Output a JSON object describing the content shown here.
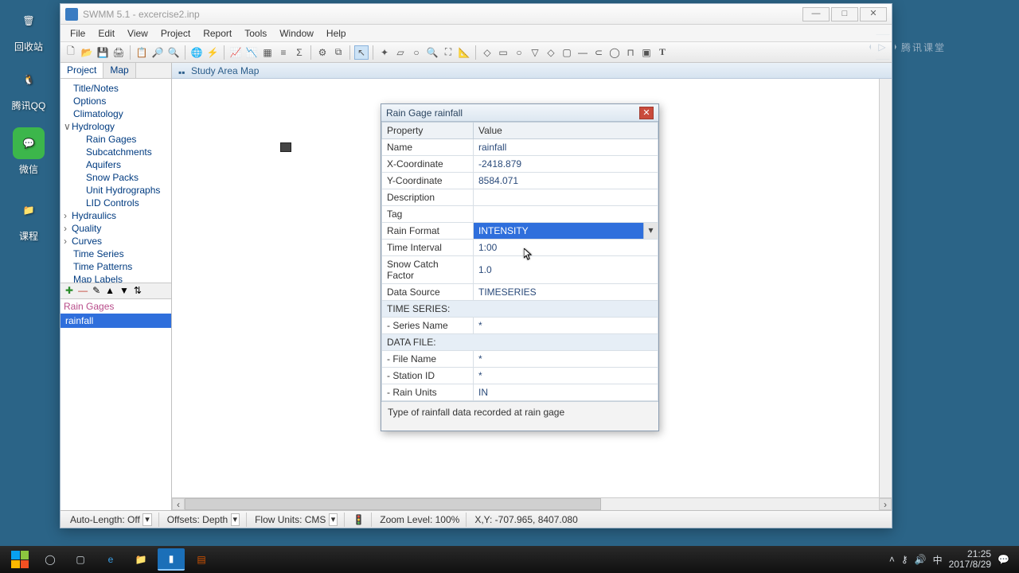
{
  "desktop_icons": [
    {
      "label": "回收站",
      "glyph": "🗑"
    },
    {
      "label": "腾讯QQ",
      "glyph": "🐧"
    },
    {
      "label": "微信",
      "glyph": "💬"
    },
    {
      "label": "课程",
      "glyph": "📁"
    }
  ],
  "window": {
    "title": "SWMM 5.1 - excercise2.inp",
    "menus": [
      "File",
      "Edit",
      "View",
      "Project",
      "Report",
      "Tools",
      "Window",
      "Help"
    ],
    "side_tabs": [
      "Project",
      "Map"
    ],
    "tree": {
      "root": [
        "Title/Notes",
        "Options",
        "Climatology"
      ],
      "hydrology": {
        "label": "Hydrology",
        "children": [
          "Rain Gages",
          "Subcatchments",
          "Aquifers",
          "Snow Packs",
          "Unit Hydrographs",
          "LID Controls"
        ]
      },
      "rest": [
        "Hydraulics",
        "Quality",
        "Curves",
        "Time Series",
        "Time Patterns",
        "Map Labels"
      ]
    },
    "objects": {
      "header": "Rain Gages",
      "items": [
        "rainfall"
      ]
    },
    "map_title": "Study Area Map",
    "status": {
      "auto_length": "Auto-Length: Off",
      "offsets": "Offsets: Depth",
      "flow_units": "Flow Units: CMS",
      "zoom": "Zoom Level: 100%",
      "coords": "X,Y: -707.965, 8407.080"
    }
  },
  "dialog": {
    "title": "Rain Gage rainfall",
    "header_property": "Property",
    "header_value": "Value",
    "rows": {
      "name_label": "Name",
      "name_value": "rainfall",
      "x_label": "X-Coordinate",
      "x_value": "-2418.879",
      "y_label": "Y-Coordinate",
      "y_value": "8584.071",
      "desc_label": "Description",
      "desc_value": "",
      "tag_label": "Tag",
      "tag_value": "",
      "rainfmt_label": "Rain Format",
      "rainfmt_value": "INTENSITY",
      "interval_label": "Time Interval",
      "interval_value": "1:00",
      "snow_label": "Snow Catch Factor",
      "snow_value": "1.0",
      "datasrc_label": "Data Source",
      "datasrc_value": "TIMESERIES",
      "ts_section": "TIME SERIES:",
      "series_label": "  - Series Name",
      "series_value": "*",
      "df_section": "DATA FILE:",
      "file_label": "  - File Name",
      "file_value": "*",
      "station_label": "  - Station ID",
      "station_value": "*",
      "units_label": "  - Rain Units",
      "units_value": "IN"
    },
    "hint": "Type of rainfall data recorded at rain gage"
  },
  "watermark": "腾讯课堂",
  "tray": {
    "time": "21:25",
    "date": "2017/8/29"
  }
}
